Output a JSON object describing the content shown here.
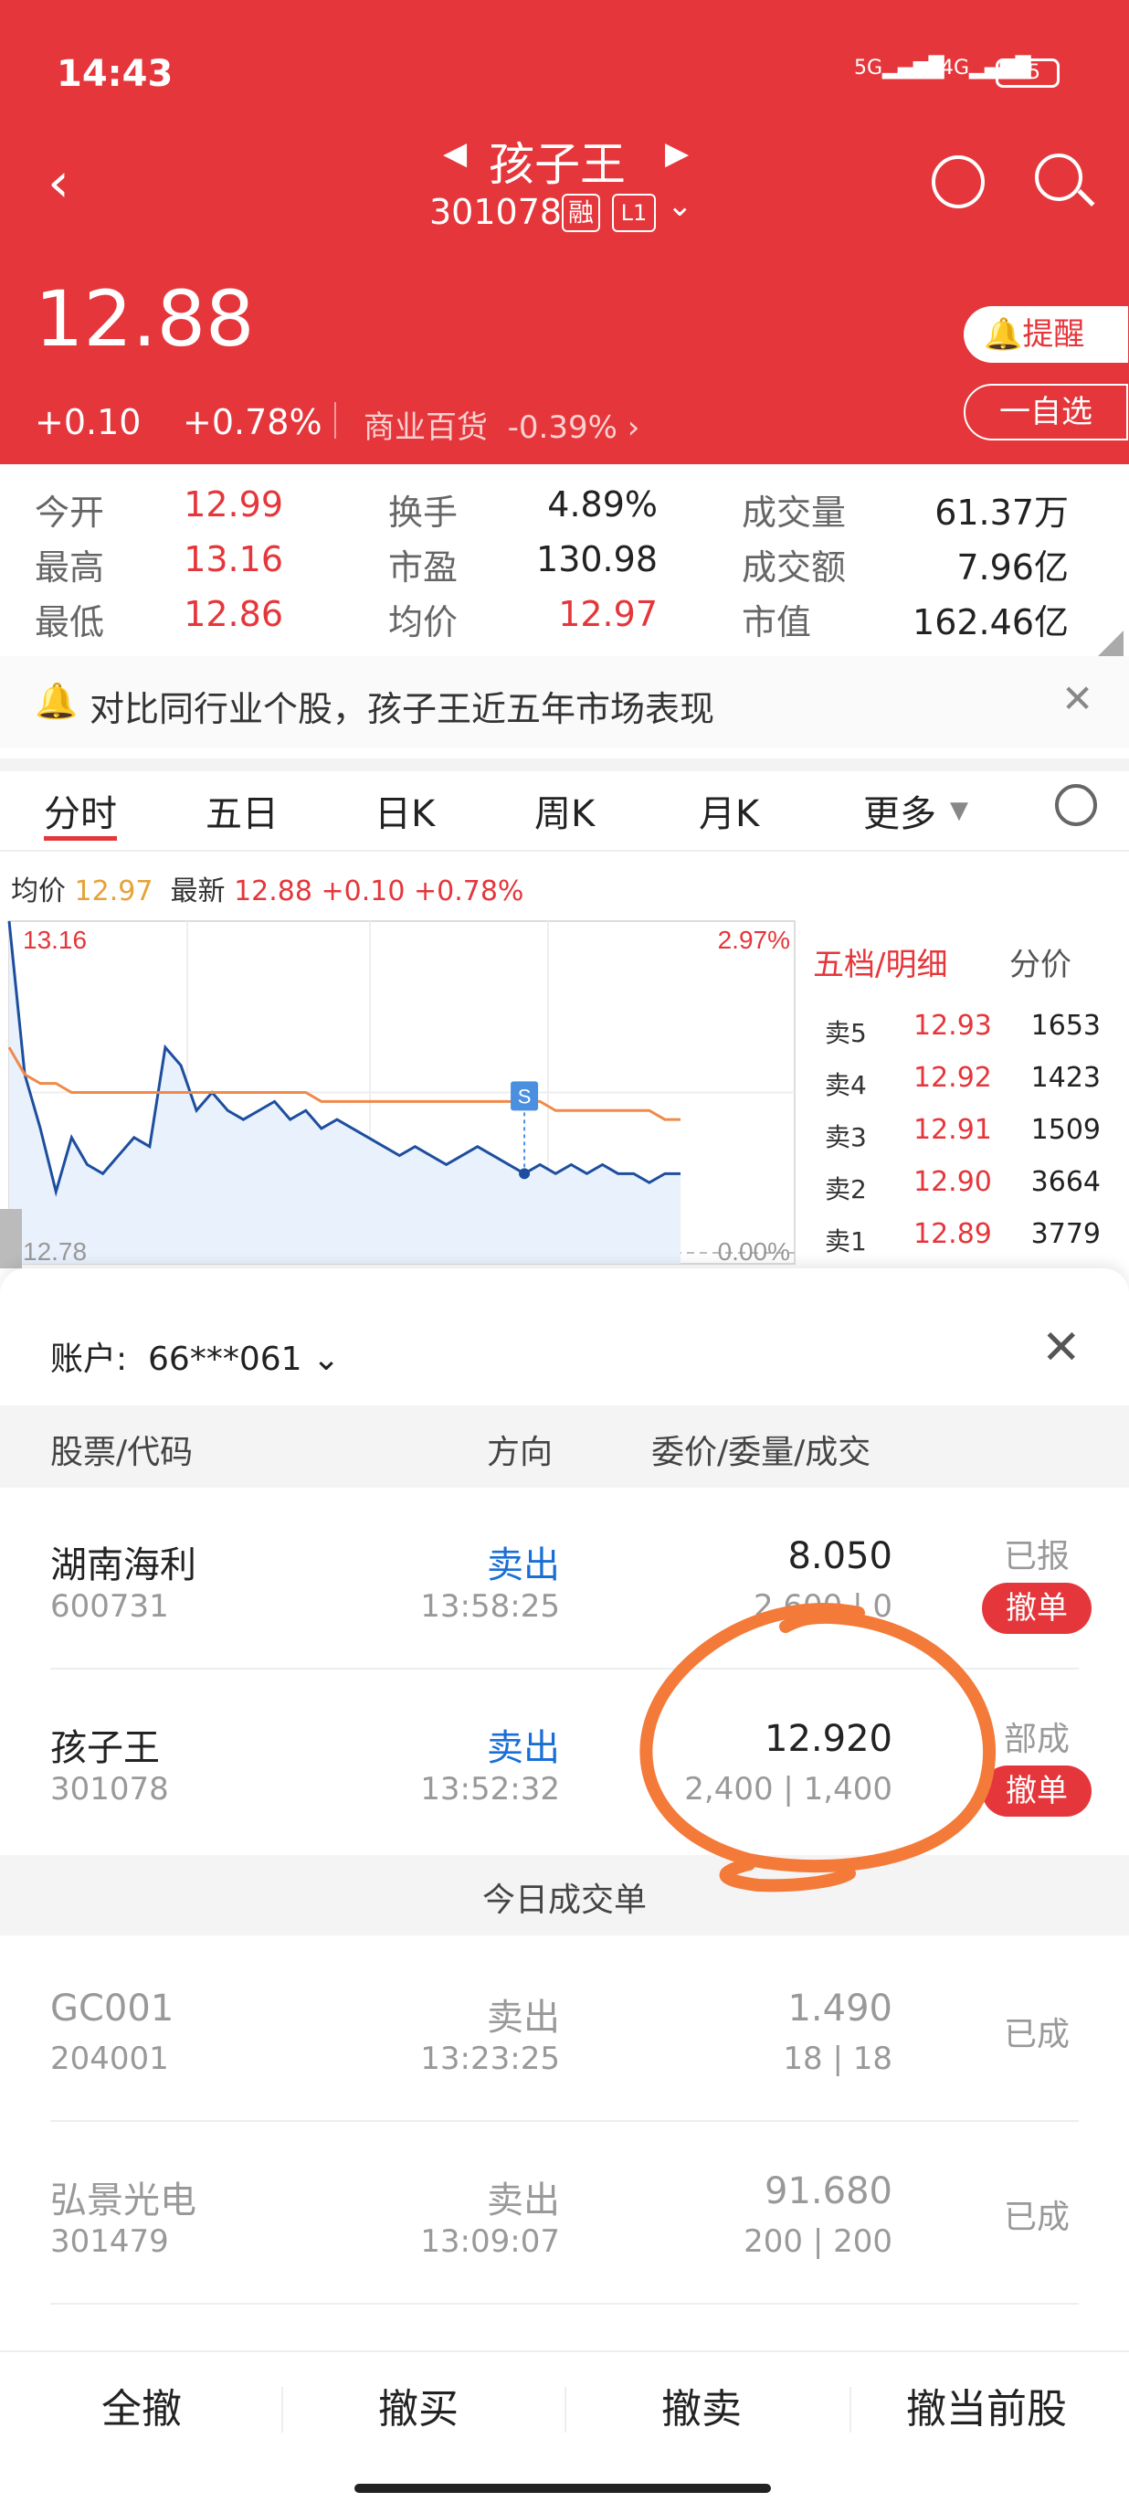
{
  "status_bar": {
    "time": "14:43",
    "net1": "5G",
    "net2": "4G",
    "battery": "85"
  },
  "header": {
    "name": "孩子王",
    "code": "301078",
    "tag_rong": "融",
    "tag_level": "L1"
  },
  "quote": {
    "price": "12.88",
    "change": "+0.10",
    "change_pct": "+0.78%",
    "sector": "商业百货",
    "sector_pct": "-0.39%",
    "remind_label": "提醒",
    "watch_label": "一自选"
  },
  "stats": [
    {
      "label": "今开",
      "value": "12.99"
    },
    {
      "label": "换手",
      "value": "4.89%"
    },
    {
      "label": "成交量",
      "value": "61.37万"
    },
    {
      "label": "最高",
      "value": "13.16"
    },
    {
      "label": "市盈",
      "value": "130.98"
    },
    {
      "label": "成交额",
      "value": "7.96亿"
    },
    {
      "label": "最低",
      "value": "12.86"
    },
    {
      "label": "均价",
      "value": "12.97"
    },
    {
      "label": "市值",
      "value": "162.46亿"
    }
  ],
  "banner": {
    "text": "对比同行业个股，孩子王近五年市场表现"
  },
  "tabs": [
    "分时",
    "五日",
    "日K",
    "周K",
    "月K",
    "更多"
  ],
  "chart_info": {
    "avg_label": "均价",
    "avg_value": "12.97",
    "latest_label": "最新",
    "latest_value": "12.88",
    "latest_change": "+0.10",
    "latest_pct": "+0.78%"
  },
  "chart_data": {
    "type": "line",
    "title": "",
    "y_high_label": "13.16",
    "y_low_label": "12.78",
    "pct_high_label": "2.97%",
    "pct_low_label": "0.00%",
    "ylim": [
      12.78,
      13.16
    ],
    "marker_label": "S",
    "series": [
      {
        "values": [
          13.16,
          12.99,
          12.93,
          12.86,
          12.92,
          12.89,
          12.88,
          12.9,
          12.92,
          12.91,
          13.02,
          13.0,
          12.95,
          12.97,
          12.95,
          12.94,
          12.95,
          12.96,
          12.94,
          12.95,
          12.93,
          12.94,
          12.93,
          12.92,
          12.91,
          12.9,
          12.91,
          12.9,
          12.89,
          12.9,
          12.91,
          12.9,
          12.89,
          12.88,
          12.89,
          12.88,
          12.89,
          12.88,
          12.89,
          12.88,
          12.88,
          12.87,
          12.88,
          12.88
        ]
      },
      {
        "values": [
          13.02,
          12.99,
          12.98,
          12.98,
          12.97,
          12.97,
          12.97,
          12.97,
          12.97,
          12.97,
          12.97,
          12.97,
          12.97,
          12.97,
          12.97,
          12.97,
          12.97,
          12.97,
          12.97,
          12.97,
          12.96,
          12.96,
          12.96,
          12.96,
          12.96,
          12.96,
          12.96,
          12.96,
          12.96,
          12.96,
          12.96,
          12.96,
          12.96,
          12.96,
          12.96,
          12.95,
          12.95,
          12.95,
          12.95,
          12.95,
          12.95,
          12.95,
          12.94,
          12.94
        ]
      }
    ]
  },
  "order_book": {
    "tab1": "五档/明细",
    "tab2": "分价",
    "rows": [
      {
        "label": "卖5",
        "price": "12.93",
        "vol": "1653"
      },
      {
        "label": "卖4",
        "price": "12.92",
        "vol": "1423"
      },
      {
        "label": "卖3",
        "price": "12.91",
        "vol": "1509"
      },
      {
        "label": "卖2",
        "price": "12.90",
        "vol": "3664"
      },
      {
        "label": "卖1",
        "price": "12.89",
        "vol": "3779"
      }
    ]
  },
  "panel": {
    "account_label": "账户:",
    "account": "66***061",
    "col_stock": "股票/代码",
    "col_dir": "方向",
    "col_price": "委价/委量/成交",
    "pending": [
      {
        "name": "湖南海利",
        "code": "600731",
        "dir": "卖出",
        "time": "13:58:25",
        "price": "8.050",
        "qty": "2,600 | 0",
        "status": "已报",
        "cancel": "撤单"
      },
      {
        "name": "孩子王",
        "code": "301078",
        "dir": "卖出",
        "time": "13:52:32",
        "price": "12.920",
        "qty": "2,400 | 1,400",
        "status": "部成",
        "cancel": "撤单"
      }
    ],
    "done_title": "今日成交单",
    "done": [
      {
        "name": "GC001",
        "code": "204001",
        "dir": "卖出",
        "time": "13:23:25",
        "price": "1.490",
        "qty": "18 | 18",
        "status": "已成"
      },
      {
        "name": "弘景光电",
        "code": "301479",
        "dir": "卖出",
        "time": "13:09:07",
        "price": "91.680",
        "qty": "200 | 200",
        "status": "已成"
      }
    ]
  },
  "bottom": [
    "全撤",
    "撤买",
    "撤卖",
    "撤当前股"
  ],
  "colors": {
    "brand_red": "#e5363b",
    "blue": "#1a6fd6",
    "orange_annotation": "#f47a3a"
  }
}
